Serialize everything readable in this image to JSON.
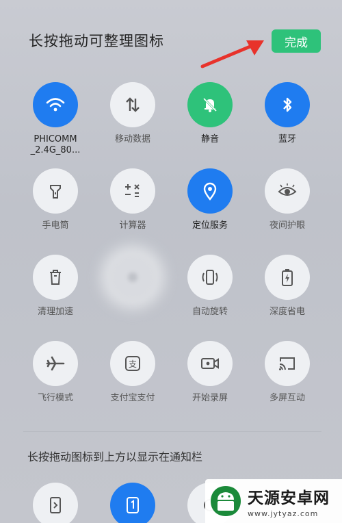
{
  "header": {
    "title": "长按拖动可整理图标",
    "done_label": "完成"
  },
  "tiles": [
    {
      "label": "PHICOMM\n_2.4G_80...",
      "icon": "wifi-icon",
      "state": "blue"
    },
    {
      "label": "移动数据",
      "icon": "mobile-data-icon",
      "state": "off"
    },
    {
      "label": "静音",
      "icon": "mute-bell-icon",
      "state": "green"
    },
    {
      "label": "蓝牙",
      "icon": "bluetooth-icon",
      "state": "blue"
    },
    {
      "label": "手电筒",
      "icon": "flashlight-icon",
      "state": "off"
    },
    {
      "label": "计算器",
      "icon": "calculator-icon",
      "state": "off"
    },
    {
      "label": "定位服务",
      "icon": "location-icon",
      "state": "blue"
    },
    {
      "label": "夜间护眼",
      "icon": "eye-icon",
      "state": "off"
    },
    {
      "label": "清理加速",
      "icon": "trash-icon",
      "state": "off"
    },
    {
      "label": "",
      "icon": "dragging-icon",
      "state": "blur"
    },
    {
      "label": "自动旋转",
      "icon": "rotate-icon",
      "state": "off"
    },
    {
      "label": "深度省电",
      "icon": "battery-icon",
      "state": "off"
    },
    {
      "label": "飞行模式",
      "icon": "airplane-icon",
      "state": "off"
    },
    {
      "label": "支付宝支付",
      "icon": "alipay-icon",
      "state": "off"
    },
    {
      "label": "开始录屏",
      "icon": "screen-record-icon",
      "state": "off"
    },
    {
      "label": "多屏互动",
      "icon": "cast-icon",
      "state": "off"
    }
  ],
  "section": {
    "subtitle": "长按拖动图标到上方以显示在通知栏"
  },
  "watermark": {
    "name": "天源安卓网",
    "url": "www.jytyaz.com"
  },
  "colors": {
    "blue": "#1f7cf0",
    "green": "#2ec27a",
    "arrow": "#e8322b"
  }
}
